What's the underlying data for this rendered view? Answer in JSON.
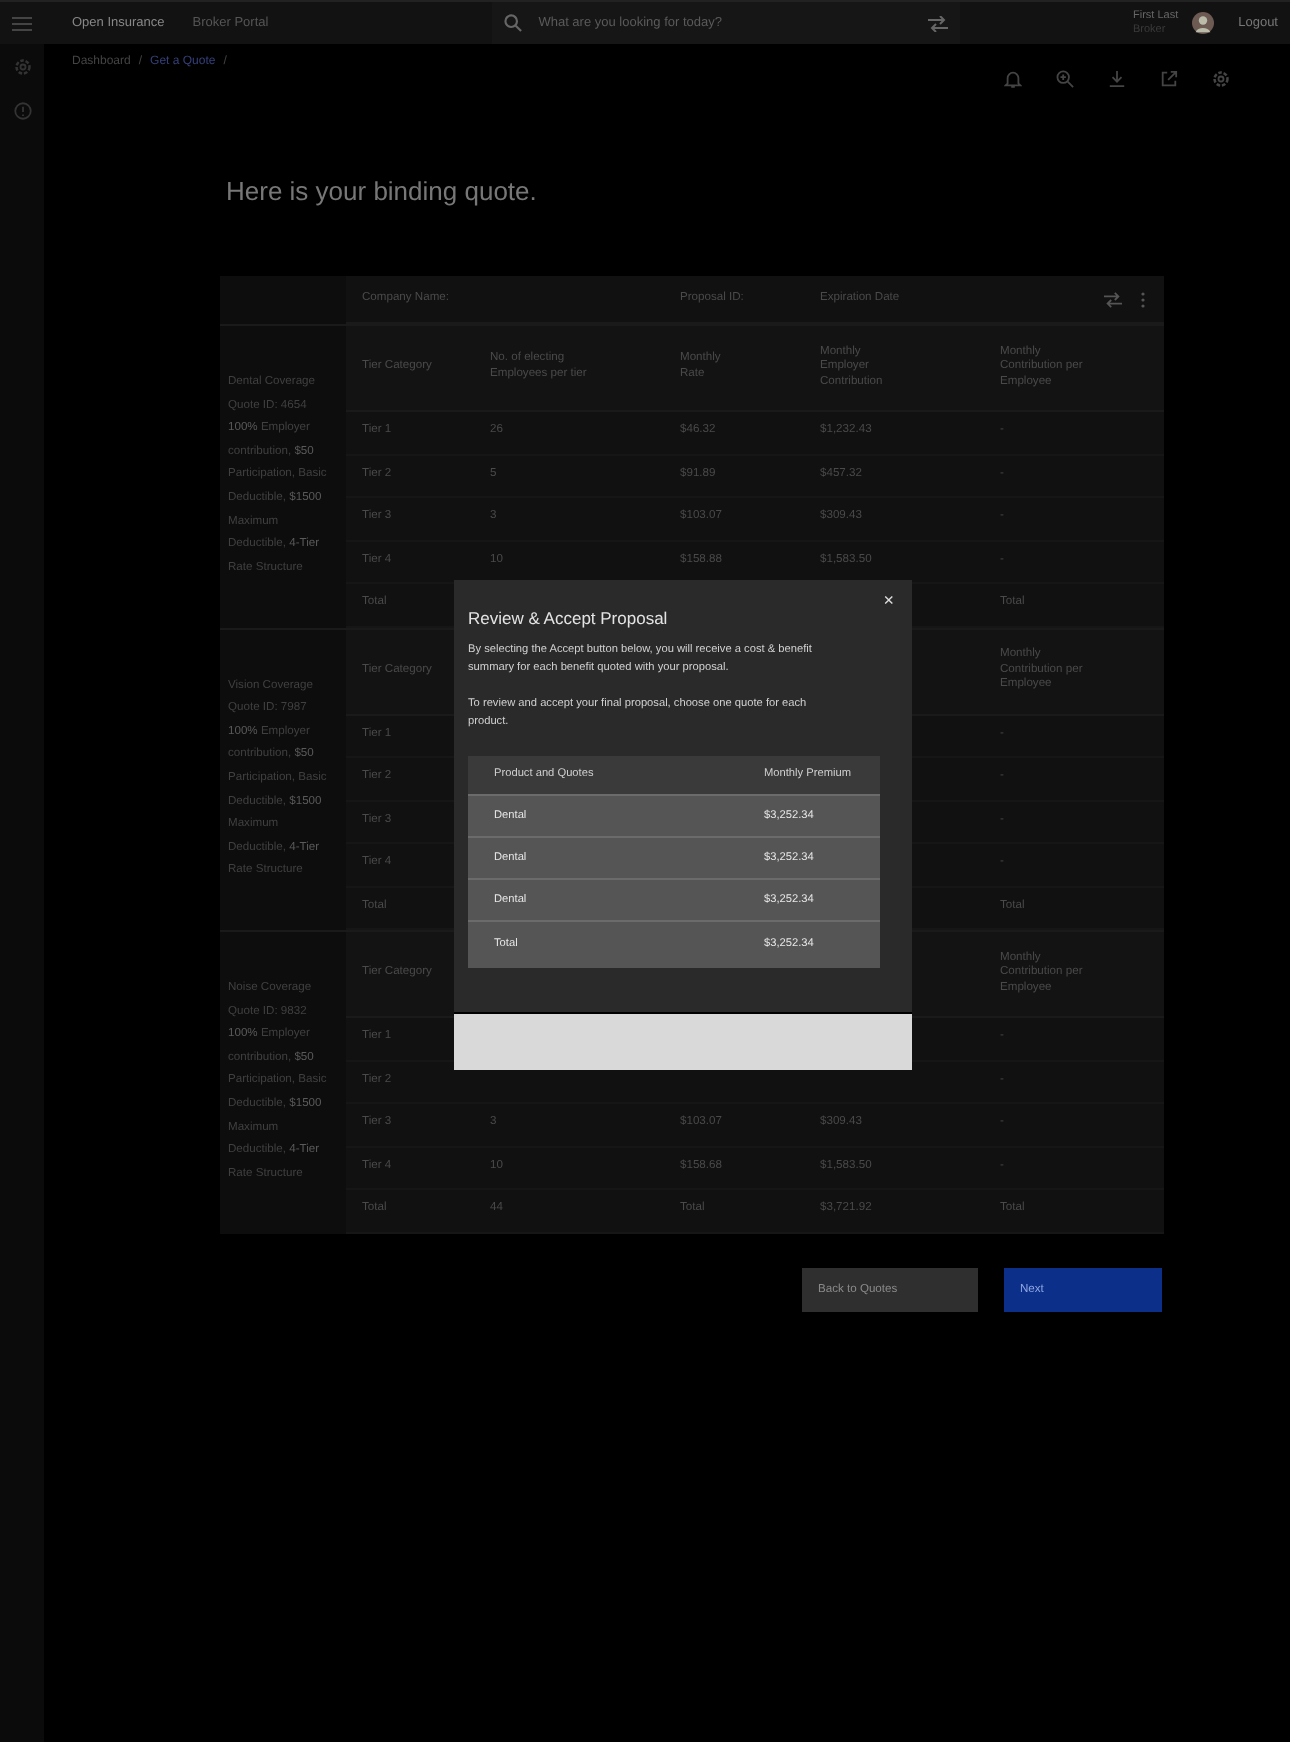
{
  "header": {
    "app_name": "Open Insurance",
    "portal": "Broker Portal",
    "search": {
      "placeholder": "What are you looking for today?"
    },
    "user": {
      "name": "First Last",
      "role": "Broker"
    },
    "logout": "Logout"
  },
  "breadcrumb": {
    "items": [
      "Dashboard",
      "Get a Quote"
    ],
    "separator": "/"
  },
  "title": "Here is your binding quote.",
  "table": {
    "toolbar": {
      "company": "Company Name:",
      "proposal": "Proposal ID:",
      "expiration": "Expiration Date"
    },
    "sections": [
      {
        "description": "Dental Coverage Quote ID: 4654 **100%** Employer contribution, **$50** Participation, Basic Deductible, **$1500** Maximum Deductible, **4-Tier** Rate Structure",
        "header": {
          "tier": "Tier Category",
          "employees": "No. of electing Employees per tier",
          "rate": "Monthly Rate",
          "employer": "Monthly Employer Contribution",
          "per_employee": "Monthly Contribution per Employee"
        },
        "rows": [
          {
            "tier": "Tier 1",
            "employees": "26",
            "rate": "$46.32",
            "employer": "$1,232.43",
            "per_employee": "-"
          },
          {
            "tier": "Tier 2",
            "employees": "5",
            "rate": "$91.89",
            "employer": "$457.32",
            "per_employee": "-"
          },
          {
            "tier": "Tier 3",
            "employees": "3",
            "rate": "$103.07",
            "employer": "$309.43",
            "per_employee": "-"
          },
          {
            "tier": "Tier 4",
            "employees": "10",
            "rate": "$158.88",
            "employer": "$1,583.50",
            "per_employee": "-"
          },
          {
            "tier": "Total",
            "per_employee": "Total"
          }
        ]
      },
      {
        "description": "Vision Coverage Quote ID: 7987 **100%** Employer contribution, **$50** Participation, Basic Deductible, **$1500** Maximum Deductible, **4-Tier** Rate Structure",
        "header": {
          "tier": "Tier Category",
          "per_employee": "Monthly Contribution per Employee"
        },
        "rows": [
          {
            "tier": "Tier 1",
            "per_employee": "-"
          },
          {
            "tier": "Tier 2",
            "per_employee": "-"
          },
          {
            "tier": "Tier 3",
            "per_employee": "-"
          },
          {
            "tier": "Tier 4",
            "per_employee": "-"
          },
          {
            "tier": "Total",
            "per_employee": "Total"
          }
        ]
      },
      {
        "description": "Noise Coverage Quote ID: 9832 **100%** Employer contribution, **$50** Participation, Basic Deductible, **$1500** Maximum Deductible, **4-Tier** Rate Structure",
        "header": {
          "tier": "Tier Category",
          "per_employee": "Monthly Contribution per Employee"
        },
        "rows": [
          {
            "tier": "Tier 1",
            "per_employee": "-"
          },
          {
            "tier": "Tier 2",
            "per_employee": "-"
          },
          {
            "tier": "Tier 3",
            "employees": "3",
            "rate": "$103.07",
            "employer": "$309.43",
            "per_employee": "-"
          },
          {
            "tier": "Tier 4",
            "employees": "10",
            "rate": "$158.68",
            "employer": "$1,583.50",
            "per_employee": "-"
          },
          {
            "tier": "Total",
            "employees": "44",
            "rate": "Total",
            "employer": "$3,721.92",
            "per_employee": "Total"
          }
        ]
      }
    ]
  },
  "modal": {
    "title": "Review & Accept Proposal",
    "close": "×",
    "paragraphs": [
      "By selecting the Accept button below, you will receive a cost & benefit summary for each benefit quoted with your proposal.",
      "To review and accept your final proposal, choose one quote for each product."
    ],
    "table": {
      "columns": [
        "Product and Quotes",
        "Monthly Premium"
      ],
      "rows": [
        {
          "product": "Dental",
          "premium": "$3,252.34"
        },
        {
          "product": "Dental",
          "premium": "$3,252.34"
        },
        {
          "product": "Dental",
          "premium": "$3,252.34"
        },
        {
          "product": "Total",
          "premium": "$3,252.34"
        }
      ]
    }
  },
  "buttons": [
    {
      "label": "Back to Quotes",
      "kind": "secondary"
    },
    {
      "label": "Next",
      "kind": "primary"
    }
  ]
}
